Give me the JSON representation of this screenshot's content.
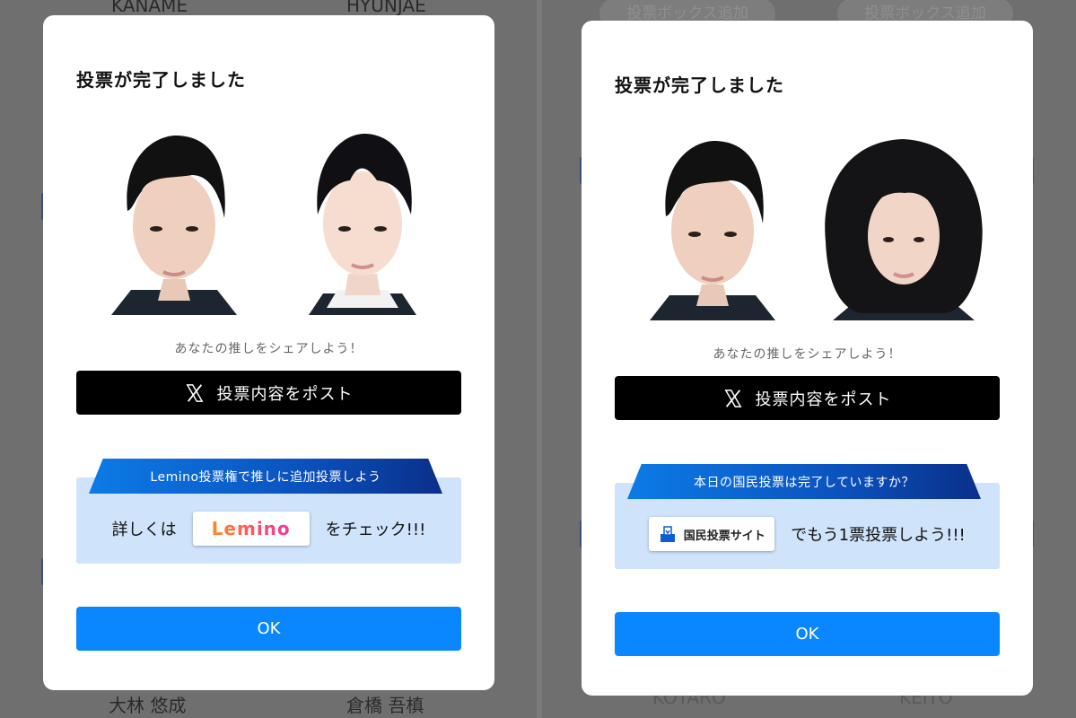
{
  "background": {
    "top_names": [
      "KANAME",
      "HYUNJAE"
    ],
    "bottom_names_left": [
      "大林 悠成",
      "倉橋 吾槙"
    ],
    "bottom_names_right": [
      "KOTARO",
      "KEITO"
    ],
    "add_box_label": "投票ボックス追加"
  },
  "modals": [
    {
      "title": "投票が完了しました",
      "share_text": "あなたの推しをシェアしよう！",
      "post_button": "投票内容をポスト",
      "promo": {
        "ribbon": "Lemino投票権で推しに追加投票しよう",
        "prefix": "詳しくは",
        "badge": "Lemino",
        "suffix": "をチェック!!!"
      },
      "ok_button": "OK"
    },
    {
      "title": "投票が完了しました",
      "share_text": "あなたの推しをシェアしよう！",
      "post_button": "投票内容をポスト",
      "promo": {
        "ribbon": "本日の国民投票は完了していますか？",
        "badge": "国民投票サイト",
        "suffix": "でもう1票投票しよう!!!"
      },
      "ok_button": "OK"
    }
  ],
  "colors": {
    "ok_button": "#0a86ff",
    "post_button": "#000000",
    "promo_bg": "#cfe3fb",
    "ribbon": "#0b52be"
  },
  "icons": [
    "x-logo-icon",
    "ballot-box-icon"
  ]
}
